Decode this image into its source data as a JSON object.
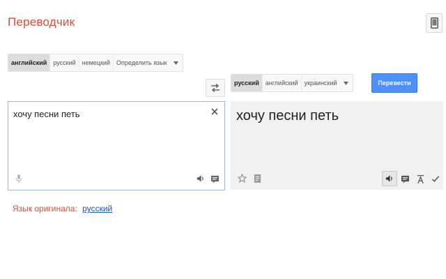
{
  "header": {
    "title": "Переводчик",
    "mobile_icon": "mobile-phone-icon"
  },
  "source": {
    "languages": [
      {
        "label": "английский",
        "active": true
      },
      {
        "label": "русский",
        "active": false
      },
      {
        "label": "немецкий",
        "active": false
      },
      {
        "label": "Определить язык",
        "active": false
      }
    ],
    "text": "хочу песни петь",
    "detected_label": "Язык оригинала:",
    "detected_language": "русский"
  },
  "target": {
    "languages": [
      {
        "label": "русский",
        "active": true
      },
      {
        "label": "английский",
        "active": false
      },
      {
        "label": "украинский",
        "active": false
      }
    ],
    "text": "хочу песни петь"
  },
  "actions": {
    "translate_label": "Перевести"
  },
  "icons": {
    "swap": "swap-languages-icon",
    "clear": "close-icon",
    "mic": "microphone-icon",
    "speak": "speaker-icon",
    "keyboard": "keyboard-icon",
    "star": "star-icon",
    "phrasebook": "phrasebook-icon",
    "feedback": "feedback-icon",
    "roman": "transliteration-icon",
    "check": "check-icon",
    "dropdown": "chevron-down-icon"
  },
  "colors": {
    "brand_red": "#dd4b39",
    "button_blue": "#4d90fe",
    "link_blue": "#1a57c8",
    "target_panel_bg": "#f1f1f1"
  }
}
